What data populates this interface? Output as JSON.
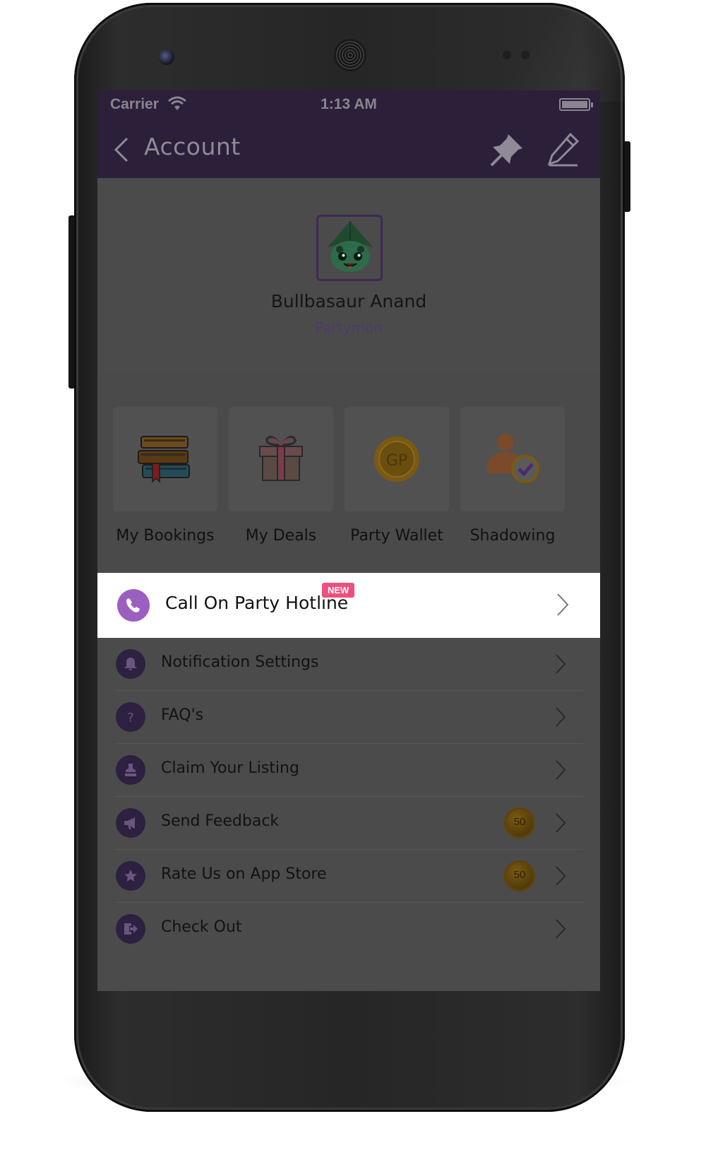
{
  "status_bar": {
    "carrier": "Carrier",
    "time": "1:13 AM"
  },
  "nav": {
    "title": "Account"
  },
  "profile": {
    "name": "Bullbasaur Anand",
    "role": "Partymon"
  },
  "tiles": [
    {
      "label": "My Bookings",
      "icon": "books-icon"
    },
    {
      "label": "My Deals",
      "icon": "gift-icon"
    },
    {
      "label": "Party Wallet",
      "icon": "gp-coin-icon",
      "coin_text": "GP"
    },
    {
      "label": "Shadowing",
      "icon": "user-check-icon"
    }
  ],
  "hotline": {
    "label": "Call On Party Hotline",
    "badge": "NEW",
    "icon": "phone-icon"
  },
  "menu": [
    {
      "label": "Notification Settings",
      "icon": "bell-icon"
    },
    {
      "label": "FAQ's",
      "icon": "question-icon"
    },
    {
      "label": "Claim Your Listing",
      "icon": "claim-icon"
    },
    {
      "label": "Send Feedback",
      "icon": "megaphone-icon",
      "coin": "50"
    },
    {
      "label": "Rate Us on App Store",
      "icon": "star-icon",
      "coin": "50"
    },
    {
      "label": "Check Out",
      "icon": "logout-icon"
    }
  ],
  "colors": {
    "header": "#2b1f3a",
    "accent": "#9b5fc0",
    "badge": "#ef4f7e",
    "coin": "#7a5a12"
  }
}
